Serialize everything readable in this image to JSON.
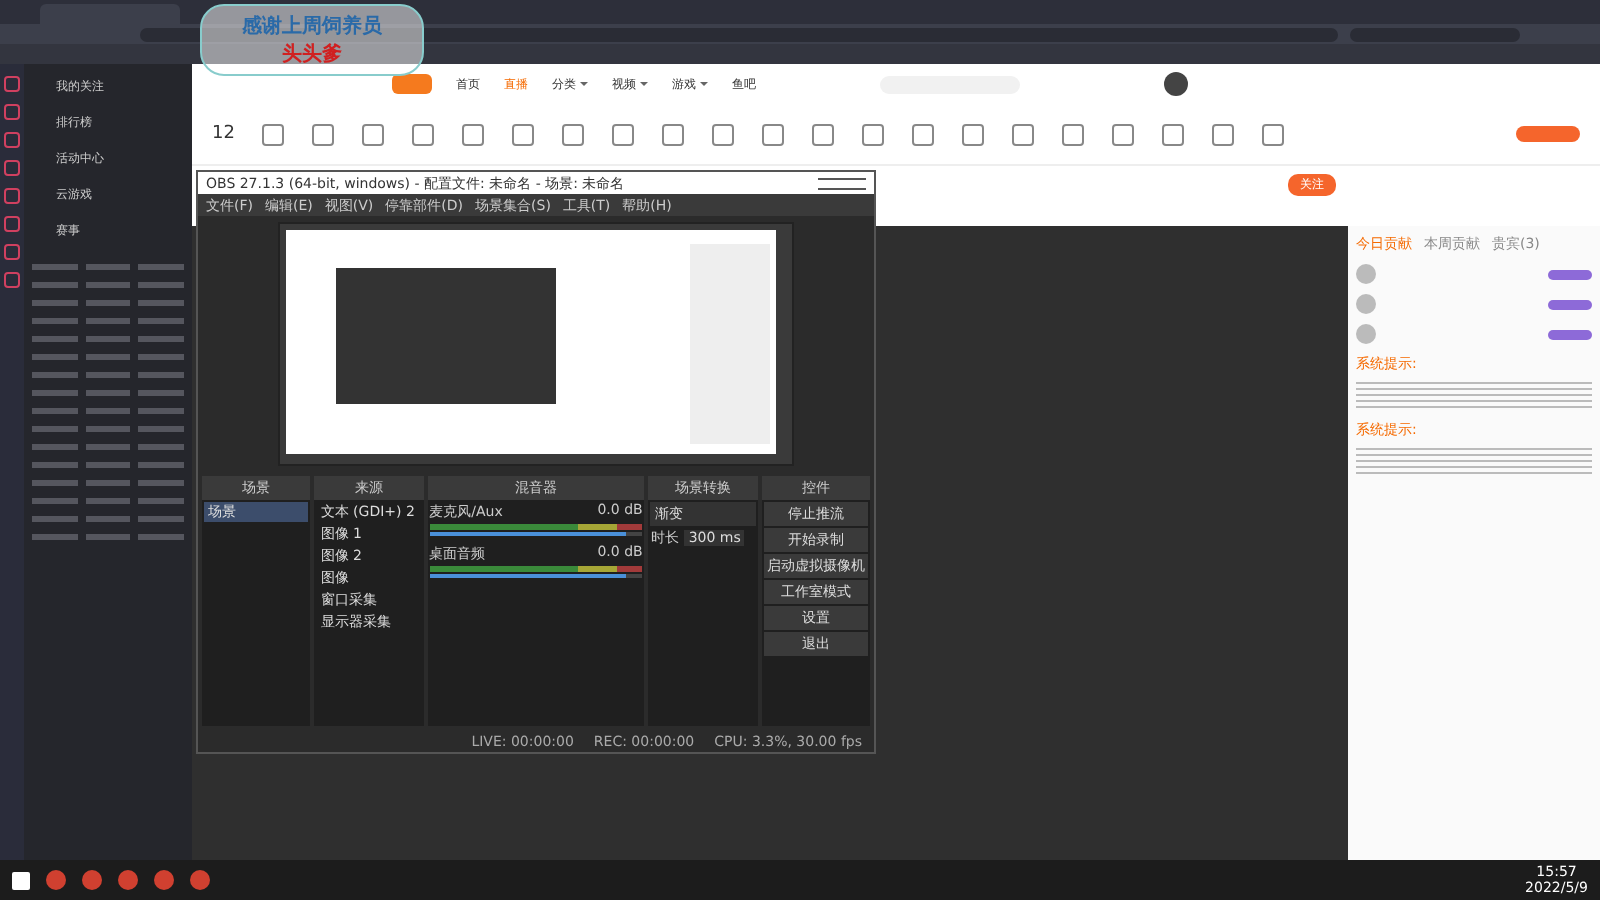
{
  "overlay": {
    "line1": "感谢上周饲养员",
    "line2": "头头爹"
  },
  "nav": [
    {
      "label": "首页",
      "selected": false,
      "has_menu": false
    },
    {
      "label": "直播",
      "selected": true,
      "has_menu": false
    },
    {
      "label": "分类",
      "selected": false,
      "has_menu": true
    },
    {
      "label": "视频",
      "selected": false,
      "has_menu": true
    },
    {
      "label": "游戏",
      "selected": false,
      "has_menu": true
    },
    {
      "label": "鱼吧",
      "selected": false,
      "has_menu": false
    }
  ],
  "toolbar": {
    "count": "12"
  },
  "sidebar": {
    "items": [
      "我的关注",
      "排行榜",
      "活动中心",
      "云游戏",
      "赛事"
    ]
  },
  "obs": {
    "title": "OBS 27.1.3 (64-bit, windows) - 配置文件: 未命名 - 场景: 未命名",
    "menu": [
      "文件(F)",
      "编辑(E)",
      "视图(V)",
      "停靠部件(D)",
      "场景集合(S)",
      "工具(T)",
      "帮助(H)"
    ],
    "docks": {
      "scenes": "场景",
      "sources": "来源",
      "mixer": "混音器",
      "transitions": "场景转换",
      "controls": "控件"
    },
    "scenes": [
      {
        "label": "场景",
        "selected": true
      }
    ],
    "sources": [
      {
        "label": "文本 (GDI+) 2"
      },
      {
        "label": "图像 1"
      },
      {
        "label": "图像 2"
      },
      {
        "label": "图像"
      },
      {
        "label": "窗口采集"
      },
      {
        "label": "显示器采集"
      }
    ],
    "mixer": [
      {
        "name": "麦克风/Aux",
        "reading": "0.0 dB",
        "level": 0.92
      },
      {
        "name": "桌面音频",
        "reading": "0.0 dB",
        "level": 0.92
      }
    ],
    "transition": {
      "value": "渐变",
      "duration_label": "时长",
      "duration": "300 ms"
    },
    "controls": [
      "停止推流",
      "开始录制",
      "启动虚拟摄像机",
      "工作室模式",
      "设置",
      "退出"
    ],
    "status": [
      "LIVE: 00:00:00",
      "REC: 00:00:00",
      "CPU: 3.3%, 30.00 fps"
    ]
  },
  "chat": {
    "follow": "关注",
    "tabs": [
      {
        "label": "今日贡献",
        "selected": true
      },
      {
        "label": "本周贡献",
        "selected": false
      },
      {
        "label": "贵宾(3)",
        "selected": false
      }
    ],
    "notices": [
      "系统提示:",
      "系统提示:"
    ]
  },
  "taskbar": {
    "time": "15:57",
    "date": "2022/5/9"
  }
}
